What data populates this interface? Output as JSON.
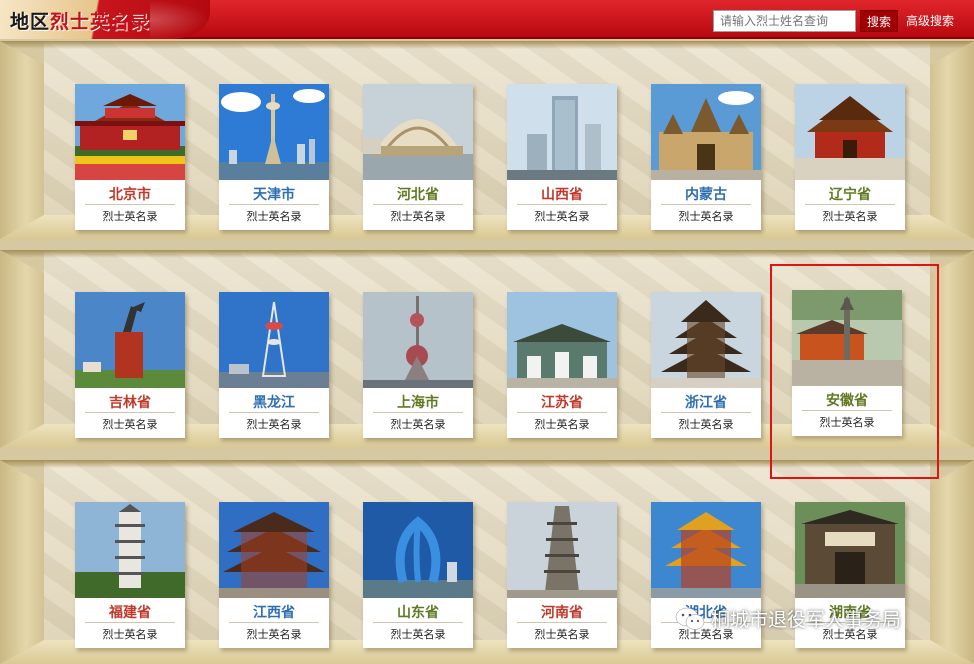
{
  "header": {
    "logo_prefix": "地区",
    "logo_accent": "烈士英名录",
    "search_placeholder": "请输入烈士姓名查询",
    "search_button": "搜索",
    "advanced_search": "高级搜索"
  },
  "card_subtitle": "烈士英名录",
  "rows": [
    [
      {
        "name": "北京市",
        "color": "#c0392b"
      },
      {
        "name": "天津市",
        "color": "#2f6fb1"
      },
      {
        "name": "河北省",
        "color": "#5f7a22"
      },
      {
        "name": "山西省",
        "color": "#c0392b"
      },
      {
        "name": "内蒙古",
        "color": "#2f6fb1"
      },
      {
        "name": "辽宁省",
        "color": "#5f7a22"
      }
    ],
    [
      {
        "name": "吉林省",
        "color": "#c0392b"
      },
      {
        "name": "黑龙江",
        "color": "#2f6fb1"
      },
      {
        "name": "上海市",
        "color": "#5f7a22"
      },
      {
        "name": "江苏省",
        "color": "#c0392b"
      },
      {
        "name": "浙江省",
        "color": "#2f6fb1"
      },
      {
        "name": "安徽省",
        "color": "#5f7a22"
      }
    ],
    [
      {
        "name": "福建省",
        "color": "#c0392b"
      },
      {
        "name": "江西省",
        "color": "#2f6fb1"
      },
      {
        "name": "山东省",
        "color": "#5f7a22"
      },
      {
        "name": "河南省",
        "color": "#c0392b"
      },
      {
        "name": "湖北省",
        "color": "#2f6fb1"
      },
      {
        "name": "湖南省",
        "color": "#5f7a22"
      }
    ]
  ],
  "watermark": "桐城市退役军人事务局",
  "highlight_color": "#e01212"
}
